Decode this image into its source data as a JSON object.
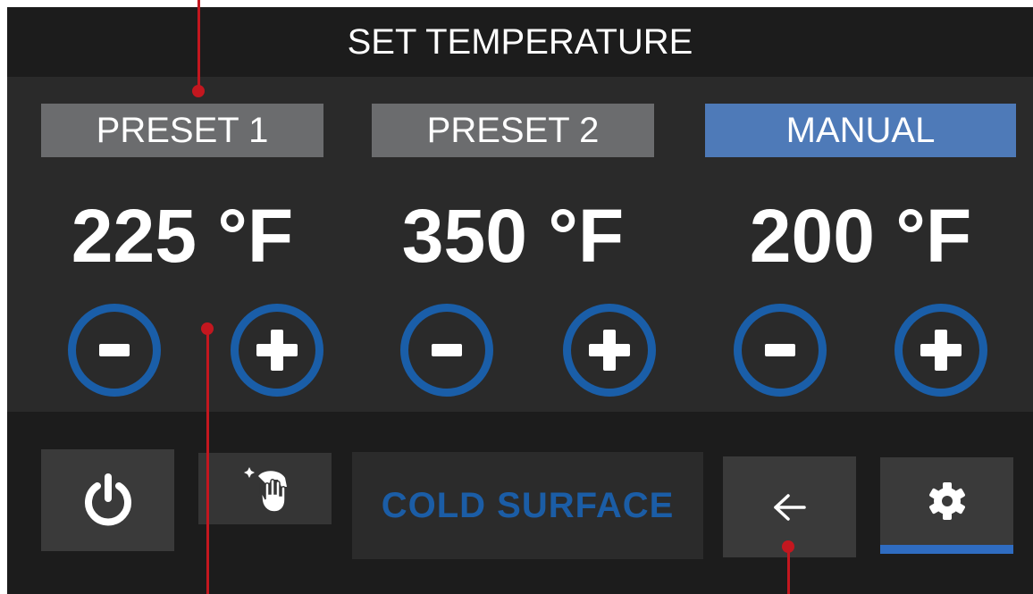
{
  "header": {
    "title": "SET TEMPERATURE"
  },
  "presets": [
    {
      "label": "PRESET 1",
      "temperature": "225 °F",
      "active": false
    },
    {
      "label": "PRESET 2",
      "temperature": "350 °F",
      "active": false
    },
    {
      "label": "MANUAL",
      "temperature": "200 °F",
      "active": true
    }
  ],
  "controls": {
    "decrease_symbol": "-",
    "increase_symbol": "+"
  },
  "toolbar": {
    "status_text": "COLD SURFACE",
    "buttons": [
      {
        "icon": "power-icon"
      },
      {
        "icon": "cleaning-icon"
      },
      {
        "icon": "back-arrow-icon"
      },
      {
        "icon": "gear-icon",
        "selected": true
      }
    ]
  },
  "colors": {
    "background": "#1c1c1c",
    "panel": "#2a2a2a",
    "tab_inactive": "#6b6c6e",
    "tab_active": "#4e7ab8",
    "button_ring": "#1a5ea8",
    "status_text": "#1b5da6",
    "callout": "#c3171f"
  }
}
